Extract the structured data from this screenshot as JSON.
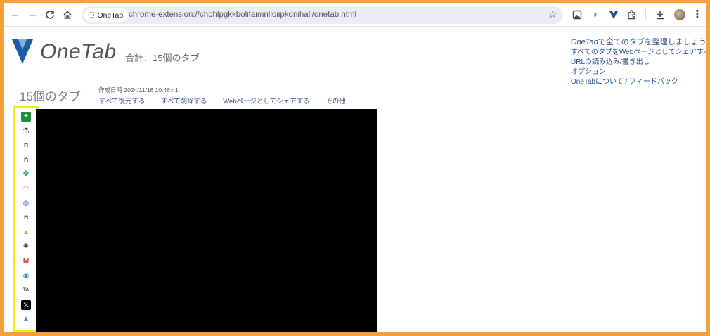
{
  "browser": {
    "site_chip_label": "OneTab",
    "url": "chrome-extension://chphlpgkkbolifaimnlloiipkdnihall/onetab.html",
    "icons": [
      "back-arrow-icon",
      "forward-arrow-icon",
      "reload-icon",
      "home-icon",
      "star-icon",
      "image-search-icon",
      "dolphin-extension-icon",
      "onetab-extension-icon",
      "puzzle-extensions-icon",
      "download-icon",
      "avatar",
      "more-vert-icon"
    ]
  },
  "header": {
    "logo_text": "OneTab",
    "total": "合計：15個のタブ"
  },
  "right_links": {
    "organize_brand": "OneTab",
    "organize_rest": "で全てのタブを整理しましょう",
    "share_all": "すべてのタブをWebページとしてシェアする",
    "import_export": "URLの読み込み/書き出し",
    "options": "オプション",
    "about": "OneTabについて / フィードバック"
  },
  "group": {
    "title": "15個のタブ",
    "created": "作成日時 2024/11/16 10:46:41",
    "actions": [
      "すべて復元する",
      "すべて削除する",
      "Webページとしてシェアする",
      "その他..."
    ]
  },
  "tabs": [
    {
      "icon": "google-sheets-icon",
      "glyph": "+",
      "color": "#1e8e3e"
    },
    {
      "icon": "flask-icon",
      "glyph": "⚗",
      "color": "#333333"
    },
    {
      "icon": "n-letter-icon",
      "glyph": "n",
      "color": "#111111"
    },
    {
      "icon": "n-letter-icon",
      "glyph": "n",
      "color": "#111111"
    },
    {
      "icon": "butterfly-icon",
      "glyph": "✤",
      "color": "#2aa198"
    },
    {
      "icon": "rainbow-icon",
      "glyph": "◠",
      "color": "#e8603c"
    },
    {
      "icon": "globe-icon",
      "glyph": "◍",
      "color": "#4a7bd0"
    },
    {
      "icon": "n-letter-icon",
      "glyph": "n",
      "color": "#111111"
    },
    {
      "icon": "cone-icon",
      "glyph": "▲",
      "color": "#e9a24a"
    },
    {
      "icon": "openai-icon",
      "glyph": "✺",
      "color": "#444444"
    },
    {
      "icon": "gmail-icon",
      "glyph": "M",
      "color": "#d93025"
    },
    {
      "icon": "edge-icon",
      "glyph": "◉",
      "color": "#1f88c9"
    },
    {
      "icon": "ta-icon",
      "glyph": "TA",
      "color": "#222222"
    },
    {
      "icon": "x-icon",
      "glyph": "𝕏",
      "color": "#000000"
    },
    {
      "icon": "google-ads-icon",
      "glyph": "▲",
      "color": "#3c8be8"
    }
  ]
}
